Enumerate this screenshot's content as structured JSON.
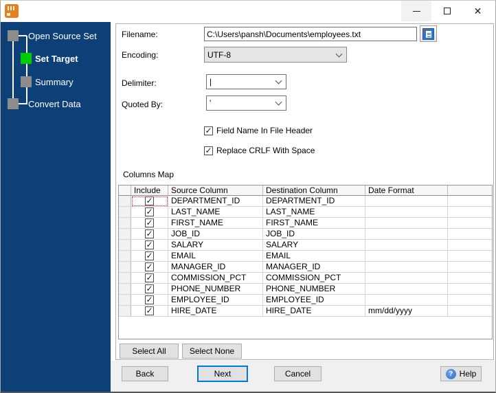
{
  "window": {
    "controls": {
      "close_glyph": "✕"
    }
  },
  "sidebar": {
    "steps": [
      {
        "label": "Open Source Set",
        "state": "completed"
      },
      {
        "label": "Set Target",
        "state": "active"
      },
      {
        "label": "Summary",
        "state": "pending"
      },
      {
        "label": "Convert Data",
        "state": "pending"
      }
    ]
  },
  "form": {
    "filename_label": "Filename:",
    "filename_value": "C:\\Users\\pansh\\Documents\\employees.txt",
    "encoding_label": "Encoding:",
    "encoding_value": "UTF-8",
    "delimiter_label": "Delimiter:",
    "delimiter_value": "|",
    "quoted_by_label": "Quoted By:",
    "quoted_by_value": "'",
    "field_name_checkbox_label": "Field Name In File Header",
    "field_name_checked": true,
    "replace_crlf_checkbox_label": "Replace CRLF With Space",
    "replace_crlf_checked": true
  },
  "columns_map": {
    "title": "Columns Map",
    "headers": [
      "",
      "Include",
      "Source Column",
      "Destination Column",
      "Date Format"
    ],
    "rows": [
      {
        "include": true,
        "source": "DEPARTMENT_ID",
        "destination": "DEPARTMENT_ID",
        "date_format": ""
      },
      {
        "include": true,
        "source": "LAST_NAME",
        "destination": "LAST_NAME",
        "date_format": ""
      },
      {
        "include": true,
        "source": "FIRST_NAME",
        "destination": "FIRST_NAME",
        "date_format": ""
      },
      {
        "include": true,
        "source": "JOB_ID",
        "destination": "JOB_ID",
        "date_format": ""
      },
      {
        "include": true,
        "source": "SALARY",
        "destination": "SALARY",
        "date_format": ""
      },
      {
        "include": true,
        "source": "EMAIL",
        "destination": "EMAIL",
        "date_format": ""
      },
      {
        "include": true,
        "source": "MANAGER_ID",
        "destination": "MANAGER_ID",
        "date_format": ""
      },
      {
        "include": true,
        "source": "COMMISSION_PCT",
        "destination": "COMMISSION_PCT",
        "date_format": ""
      },
      {
        "include": true,
        "source": "PHONE_NUMBER",
        "destination": "PHONE_NUMBER",
        "date_format": ""
      },
      {
        "include": true,
        "source": "EMPLOYEE_ID",
        "destination": "EMPLOYEE_ID",
        "date_format": ""
      },
      {
        "include": true,
        "source": "HIRE_DATE",
        "destination": "HIRE_DATE",
        "date_format": "mm/dd/yyyy"
      }
    ],
    "select_all_label": "Select All",
    "select_none_label": "Select None"
  },
  "footer": {
    "back_label": "Back",
    "next_label": "Next",
    "cancel_label": "Cancel",
    "help_label": "Help",
    "help_icon_glyph": "?"
  },
  "colors": {
    "sidebar_bg": "#0E4078",
    "active_step_green": "#00CC00",
    "inactive_step_gray": "#8C8C8C",
    "next_focus_border": "#0078D7",
    "help_icon_blue": "#2F6CC9",
    "focus_cell_red": "#FF1A1A",
    "browse_icon_blue": "#2E74C8",
    "app_icon_orange": "#E87E1E"
  }
}
